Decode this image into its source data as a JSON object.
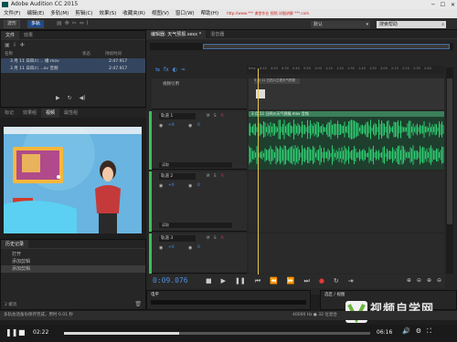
{
  "window": {
    "title": "Adobe Audition CC 2015"
  },
  "menu": {
    "items": [
      "文件(F)",
      "编辑(E)",
      "多轨(M)",
      "剪辑(C)",
      "效果(S)",
      "收藏夹(R)",
      "视图(V)",
      "窗口(W)",
      "帮助(H)"
    ],
    "url_overlay": "http://www.*** 课堂作业 视频 详细讲解 ***.com"
  },
  "toolbar": {
    "waveform_label": "波形",
    "multitrack_label": "多轨",
    "workspace": "默认",
    "help_search": "搜索帮助"
  },
  "files_panel": {
    "tabs": [
      "文件",
      "效果"
    ],
    "columns": {
      "name": "名称",
      "status": "状态",
      "duration": "持续时间"
    },
    "rows": [
      {
        "name": "3 月 11 日四川 ... 播.mov",
        "duration": "2:47.917"
      },
      {
        "name": "3 月 11 日四川 ...ov 音频",
        "duration": "2:47.917"
      }
    ]
  },
  "media_tabs": [
    "标记",
    "效果组",
    "视频",
    "属性组"
  ],
  "history": {
    "title": "历史记录",
    "items": [
      "打开",
      "添加剪辑",
      "添加剪辑"
    ],
    "footer": "2 撤消"
  },
  "editor": {
    "tab_title": "编辑器: 天气预报.sesx *",
    "mixer_tab": "混音器",
    "video_track": "视频引用",
    "video_clip": "3 月 11 日四川卫视天气预报",
    "tracks": [
      {
        "name": "轨道 1",
        "volume": "+0",
        "pan": "0",
        "mode": "读取",
        "clip": "3 月 11 日四川天气预报.mov 音频"
      },
      {
        "name": "轨道 2",
        "volume": "+0",
        "pan": "0",
        "mode": "读取",
        "clip": ""
      },
      {
        "name": "轨道 3",
        "volume": "+0",
        "pan": "0",
        "mode": "读取",
        "clip": ""
      }
    ],
    "time": "0:09.076",
    "level_tab": "电平",
    "selection_tab": "选区 / 视图",
    "ruler_marks": [
      "hms",
      "0:10",
      "0:20",
      "0:30",
      "0:40",
      "0:50",
      "1:00",
      "1:10",
      "1:20",
      "1:30",
      "1:40",
      "1:50",
      "2:00",
      "2:10",
      "2:20",
      "2:30",
      "2:40"
    ]
  },
  "status": {
    "left": "多轨会话备份保存完成，用时 0.01 秒",
    "right": "40000 Hz ● 32 位混合"
  },
  "player": {
    "elapsed": "02:22",
    "total": "06:16",
    "progress": 0.377
  },
  "watermark": {
    "logo_text": "视频自学网",
    "url": "www.zixue.net"
  },
  "colors": {
    "accent": "#4a90e2",
    "wave": "#2ecc71",
    "playhead": "#e6c94a",
    "record": "#e03a3a"
  }
}
